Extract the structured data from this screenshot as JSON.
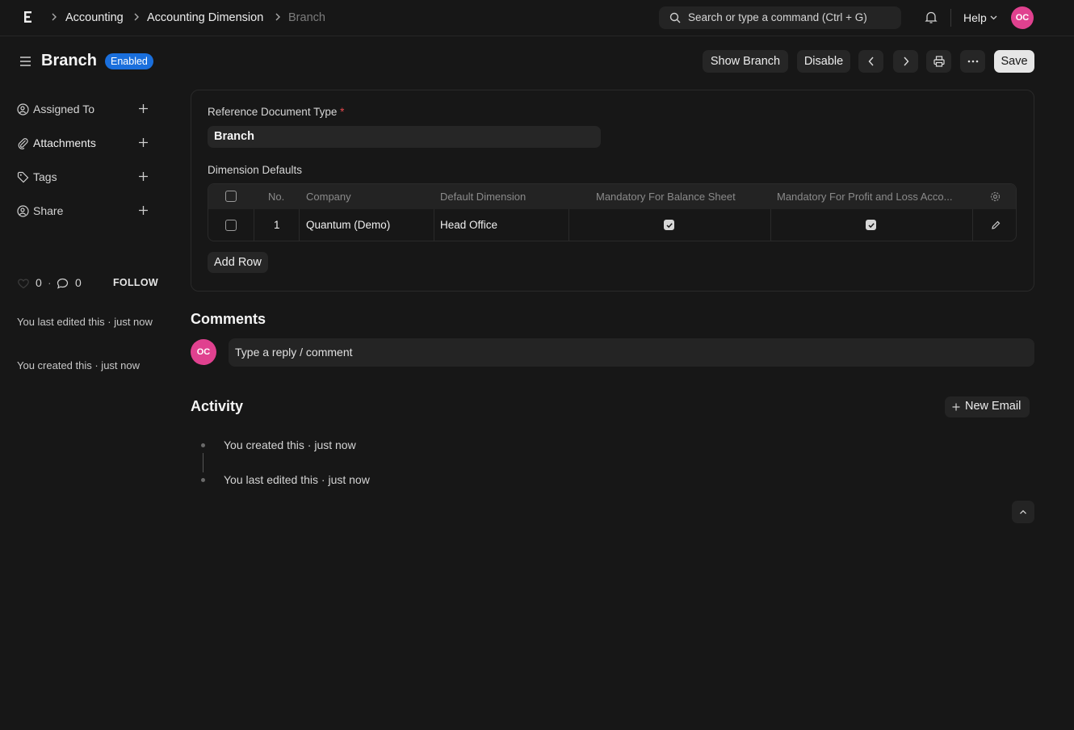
{
  "navbar": {
    "breadcrumbs": [
      "Accounting",
      "Accounting Dimension",
      "Branch"
    ],
    "search_placeholder": "Search or type a command (Ctrl + G)",
    "help_label": "Help",
    "avatar_initials": "OC"
  },
  "page": {
    "title": "Branch",
    "status_badge": "Enabled",
    "actions": {
      "show_branch": "Show Branch",
      "disable": "Disable",
      "save": "Save"
    }
  },
  "sidebar": {
    "items": [
      {
        "label": "Assigned To",
        "icon": "user-plus-icon"
      },
      {
        "label": "Attachments",
        "icon": "paperclip-icon"
      },
      {
        "label": "Tags",
        "icon": "tag-icon"
      },
      {
        "label": "Share",
        "icon": "share-user-icon"
      }
    ],
    "likes_count": "0",
    "comments_count": "0",
    "follow_label": "FOLLOW",
    "last_edited": "You last edited this · just now",
    "created": "You created this · just now"
  },
  "form": {
    "reference_label": "Reference Document Type",
    "reference_required_mark": "*",
    "reference_value": "Branch",
    "dimension_defaults_label": "Dimension Defaults",
    "table": {
      "columns": [
        "No.",
        "Company",
        "Default Dimension",
        "Mandatory For Balance Sheet",
        "Mandatory For Profit and Loss Acco..."
      ],
      "rows": [
        {
          "no": "1",
          "company": "Quantum (Demo)",
          "default_dimension": "Head Office",
          "mandatory_bs": true,
          "mandatory_pl": true
        }
      ]
    },
    "add_row_label": "Add Row"
  },
  "comments": {
    "heading": "Comments",
    "avatar_initials": "OC",
    "placeholder": "Type a reply / comment"
  },
  "activity": {
    "heading": "Activity",
    "new_email_label": "New Email",
    "items": [
      "You created this · just now",
      "You last edited this · just now"
    ]
  }
}
